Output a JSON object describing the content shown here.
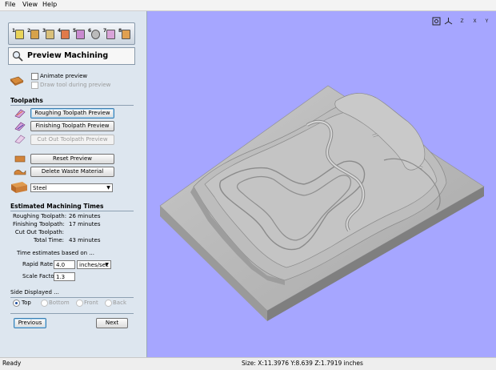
{
  "menu": {
    "file": "File",
    "view": "View",
    "help": "Help"
  },
  "panel": {
    "title": "Preview Machining",
    "steps": [
      "1",
      "2",
      "3",
      "4",
      "5",
      "6",
      "7",
      "8"
    ],
    "animate_label": "Animate preview",
    "draw_tool_label": "Draw tool during preview",
    "toolpaths_header": "Toolpaths",
    "roughing_btn": "Roughing Toolpath Preview",
    "finishing_btn": "Finishing Toolpath Preview",
    "cutout_btn": "Cut Out Toolpath Preview",
    "reset_btn": "Reset Preview",
    "delete_btn": "Delete Waste Material",
    "material": "Steel",
    "times_header": "Estimated Machining Times",
    "times": {
      "roughing_label": "Roughing Toolpath:",
      "roughing_value": "26 minutes",
      "finishing_label": "Finishing Toolpath:",
      "finishing_value": "17 minutes",
      "cutout_label": "Cut Out Toolpath:",
      "cutout_value": "",
      "total_label": "Total Time:",
      "total_value": "43 minutes"
    },
    "estimates_note": "Time estimates based on ...",
    "rapid_label": "Rapid Rate",
    "rapid_value": "4.0",
    "rapid_unit": "inches/sec",
    "scale_label": "Scale Factor",
    "scale_value": "1.3",
    "side_header": "Side Displayed ...",
    "side_options": {
      "top": "Top",
      "bottom": "Bottom",
      "front": "Front",
      "back": "Back"
    },
    "previous_btn": "Previous",
    "next_btn": "Next"
  },
  "view_buttons": {
    "x": "X",
    "y": "Y",
    "z": "Z"
  },
  "status": {
    "ready": "Ready",
    "size": "Size: X:11.3976 Y:8.639 Z:1.7919 inches"
  },
  "colors": {
    "viewport": "#a6a6ff",
    "panel": "#dde6ef",
    "model": "#b4b4b4"
  }
}
